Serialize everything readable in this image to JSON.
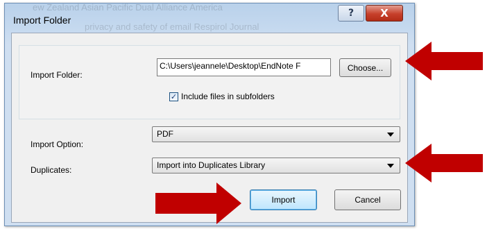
{
  "window": {
    "title": "Import Folder",
    "help_glyph": "?",
    "close_glyph": "X",
    "background_text_1": "ew Zealand    Asian Pacific Dual Alliance    America",
    "background_text_2": "privacy and safety of email      Respirol      Journal"
  },
  "form": {
    "import_folder_label": "Import Folder:",
    "folder_path": "C:\\Users\\jeannele\\Desktop\\EndNote F",
    "choose_button": "Choose...",
    "include_subfolders_label": "Include files in subfolders",
    "include_subfolders_checked": true,
    "checkmark": "✓",
    "import_option_label": "Import Option:",
    "import_option_value": "PDF",
    "duplicates_label": "Duplicates:",
    "duplicates_value": "Import into Duplicates Library"
  },
  "actions": {
    "import_button": "Import",
    "cancel_button": "Cancel"
  },
  "annotations": {
    "arrow_color": "#c00000",
    "arrow_targets": [
      "choose-button",
      "duplicates-select",
      "import-button"
    ]
  }
}
